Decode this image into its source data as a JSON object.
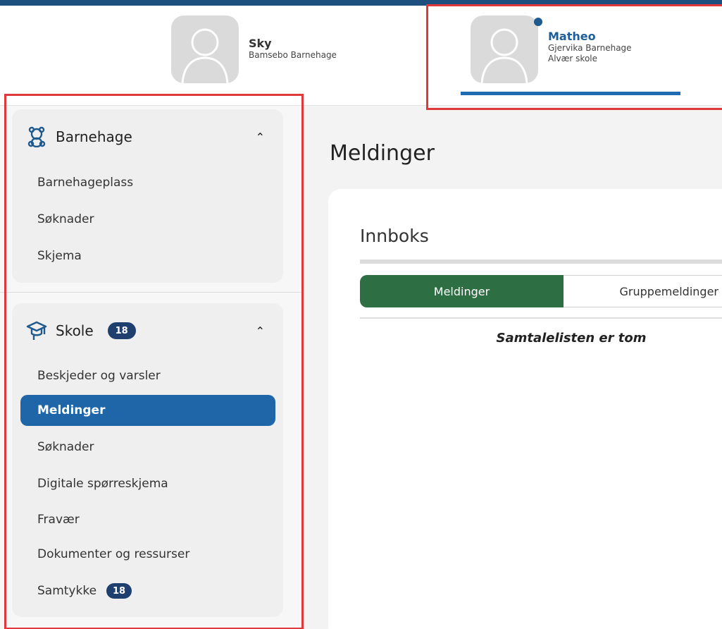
{
  "children": [
    {
      "name": "Sky",
      "lines": [
        "Bamsebo Barnehage"
      ],
      "active": false
    },
    {
      "name": "Matheo",
      "lines": [
        "Gjervika Barnehage",
        "Alvær skole"
      ],
      "active": true,
      "has_notification": true
    }
  ],
  "sidebar": {
    "barnehage": {
      "title": "Barnehage",
      "icon": "teddy-bear-icon",
      "expanded": true,
      "items": [
        {
          "label": "Barnehageplass"
        },
        {
          "label": "Søknader"
        },
        {
          "label": "Skjema"
        }
      ]
    },
    "skole": {
      "title": "Skole",
      "icon": "graduation-cap-icon",
      "badge": "18",
      "expanded": true,
      "items": [
        {
          "label": "Beskjeder og varsler"
        },
        {
          "label": "Meldinger",
          "active": true
        },
        {
          "label": "Søknader"
        },
        {
          "label": "Digitale spørreskjema"
        },
        {
          "label": "Fravær"
        },
        {
          "label": "Dokumenter og ressurser"
        },
        {
          "label": "Samtykke",
          "badge": "18"
        }
      ]
    }
  },
  "main": {
    "title": "Meldinger",
    "inbox_title": "Innboks",
    "tabs": [
      {
        "label": "Meldinger",
        "active": true
      },
      {
        "label": "Gruppemeldinger",
        "active": false
      }
    ],
    "empty_message": "Samtalelisten er tom"
  },
  "colors": {
    "primary_blue": "#1f66a8",
    "active_tab_green": "#2e6e43",
    "badge_navy": "#1f3f6e",
    "highlight_red": "#e0393b"
  }
}
